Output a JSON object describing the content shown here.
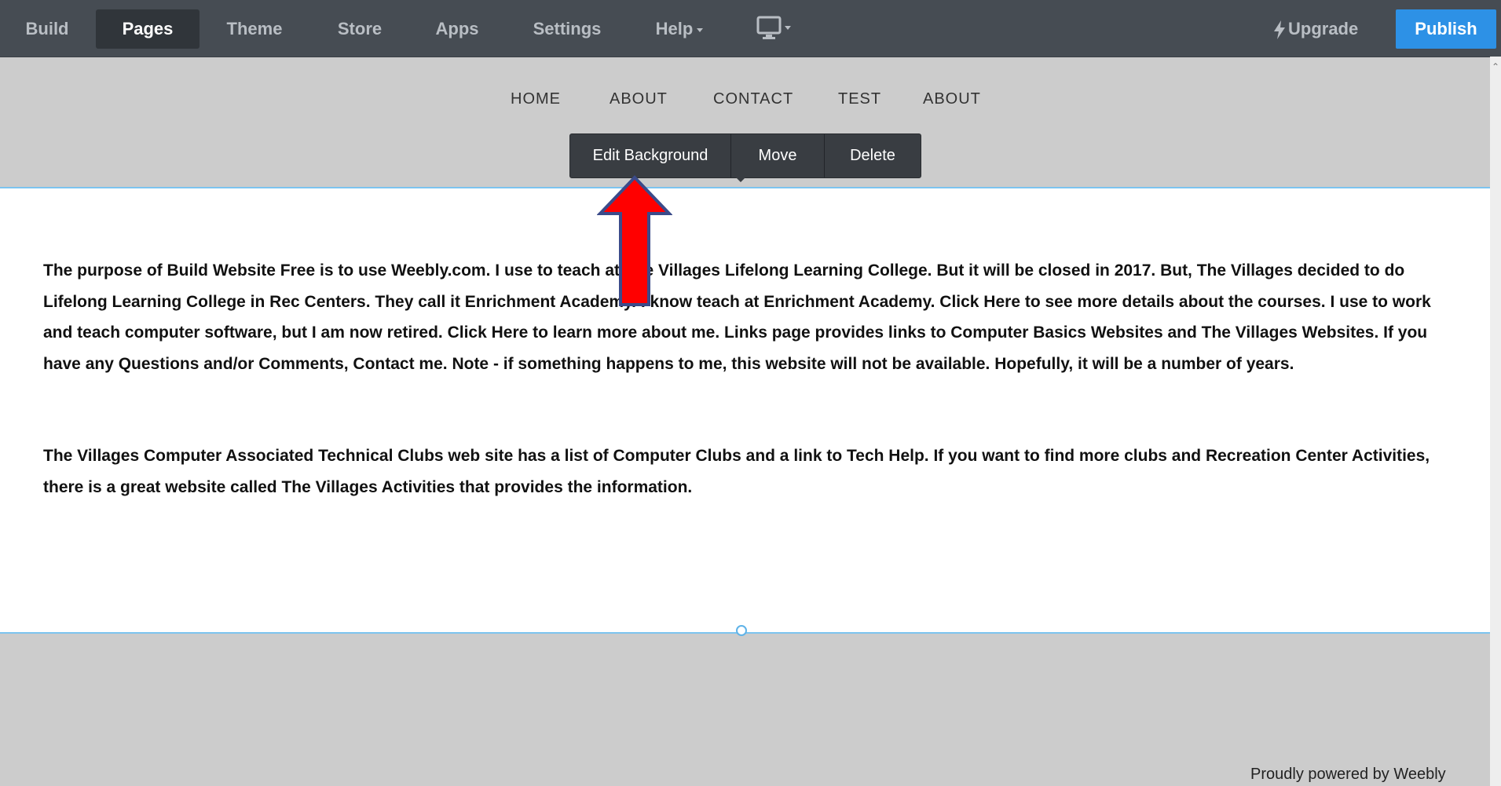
{
  "toolbar": {
    "tabs": [
      {
        "label": "Build"
      },
      {
        "label": "Pages"
      },
      {
        "label": "Theme"
      },
      {
        "label": "Store"
      },
      {
        "label": "Apps"
      },
      {
        "label": "Settings"
      },
      {
        "label": "Help"
      }
    ],
    "active_tab": "Pages",
    "device_icon": "desktop-monitor-icon",
    "upgrade_label": "Upgrade",
    "publish_label": "Publish"
  },
  "site": {
    "nav": [
      {
        "label": "HOME"
      },
      {
        "label": "ABOUT"
      },
      {
        "label": "CONTACT"
      },
      {
        "label": "TEST"
      },
      {
        "label": "ABOUT"
      }
    ]
  },
  "context_menu": {
    "edit_background": "Edit Background",
    "move": "Move",
    "delete": "Delete"
  },
  "content": {
    "paragraph1": "The purpose of Build Website Free is to use Weebly.com.  I use to teach at The Villages Lifelong Learning College. But it will be closed in 2017.  But, The Villages decided to do Lifelong Learning College in Rec Centers.  They call it Enrichment Academy. I know teach at Enrichment Academy.  Click Here to see more details about the courses.  I use to work and teach computer software, but I am now retired.  Click Here to learn more about me.  Links page provides links to Computer Basics Websites and The Villages Websites.  If you have any Questions and/or Comments, Contact me. Note - if something happens to me, this website will not be available.  Hopefully, it will be a number of years.",
    "paragraph2": "The Villages Computer  Associated Technical Clubs web site has a list of Computer Clubs and a link to Tech Help.  If you want to find more clubs and Recreation Center Activities, there is a great website called The Villages Activities that provides the information."
  },
  "footer": {
    "text": "Proudly powered by Weebly"
  },
  "colors": {
    "toolbar_bg": "#464c53",
    "publish_blue": "#2d91e6",
    "selection_blue": "#7cc4ef",
    "annotation_red": "#ff0000"
  }
}
